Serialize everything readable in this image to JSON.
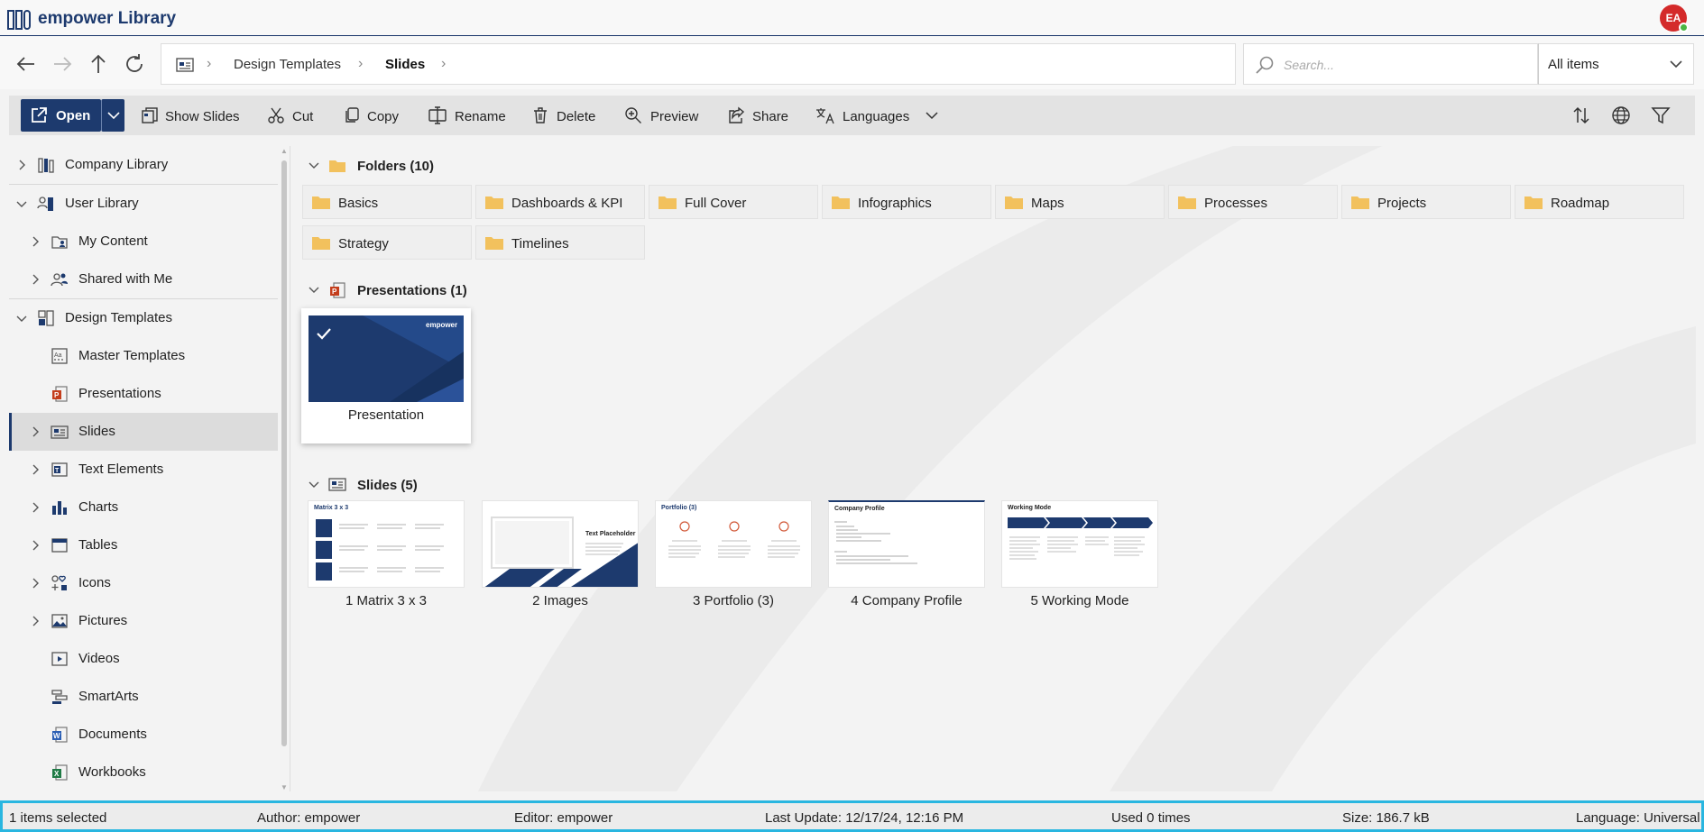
{
  "app": {
    "title": "empower Library",
    "avatar_initials": "EA"
  },
  "breadcrumb": {
    "items": [
      "Design Templates",
      "Slides"
    ]
  },
  "search": {
    "placeholder": "Search...",
    "scope": "All items"
  },
  "toolbar": {
    "open": "Open",
    "show_slides": "Show Slides",
    "cut": "Cut",
    "copy": "Copy",
    "rename": "Rename",
    "delete": "Delete",
    "preview": "Preview",
    "share": "Share",
    "languages": "Languages"
  },
  "sidebar": {
    "items": [
      {
        "label": "Company Library",
        "icon": "library-icon",
        "expandable": true
      },
      {
        "label": "User Library",
        "icon": "user-library-icon",
        "expanded": true
      },
      {
        "label": "My Content",
        "icon": "my-content-icon",
        "expandable": true
      },
      {
        "label": "Shared with Me",
        "icon": "shared-icon",
        "expandable": true
      },
      {
        "label": "Design Templates",
        "icon": "design-templates-icon",
        "expanded": true
      },
      {
        "label": "Master Templates",
        "icon": "master-templates-icon"
      },
      {
        "label": "Presentations",
        "icon": "presentation-icon"
      },
      {
        "label": "Slides",
        "icon": "slides-icon",
        "expandable": true,
        "selected": true
      },
      {
        "label": "Text Elements",
        "icon": "text-elements-icon",
        "expandable": true
      },
      {
        "label": "Charts",
        "icon": "chart-icon",
        "expandable": true
      },
      {
        "label": "Tables",
        "icon": "table-icon",
        "expandable": true
      },
      {
        "label": "Icons",
        "icon": "icons-icon",
        "expandable": true
      },
      {
        "label": "Pictures",
        "icon": "picture-icon",
        "expandable": true
      },
      {
        "label": "Videos",
        "icon": "video-icon"
      },
      {
        "label": "SmartArts",
        "icon": "smartart-icon"
      },
      {
        "label": "Documents",
        "icon": "document-icon"
      },
      {
        "label": "Workbooks",
        "icon": "workbook-icon"
      }
    ]
  },
  "main": {
    "folders_header": "Folders (10)",
    "folders": [
      "Basics",
      "Dashboards & KPI",
      "Full Cover",
      "Infographics",
      "Maps",
      "Processes",
      "Projects",
      "Roadmap",
      "Strategy",
      "Timelines"
    ],
    "presentations_header": "Presentations (1)",
    "presentation": {
      "caption": "Presentation",
      "brand": "empower"
    },
    "slides_header": "Slides (5)",
    "slides": [
      {
        "caption": "1 Matrix 3 x 3",
        "thumb_title": "Matrix 3 x 3"
      },
      {
        "caption": "2 Images",
        "thumb_title": "Text Placeholder"
      },
      {
        "caption": "3 Portfolio (3)",
        "thumb_title": "Portfolio (3)"
      },
      {
        "caption": "4 Company Profile",
        "thumb_title": "Company Profile"
      },
      {
        "caption": "5 Working Mode",
        "thumb_title": "Working Mode"
      }
    ]
  },
  "status": {
    "selected": "1 items selected",
    "author": "Author: empower",
    "editor": "Editor: empower",
    "last_update": "Last Update: 12/17/24, 12:16 PM",
    "used": "Used 0 times",
    "size": "Size: 186.7 kB",
    "language": "Language: Universal"
  },
  "colors": {
    "brand": "#1d3a6e",
    "folder": "#f2c15d",
    "status_border": "#29b6e0",
    "avatar": "#d42a2a"
  }
}
